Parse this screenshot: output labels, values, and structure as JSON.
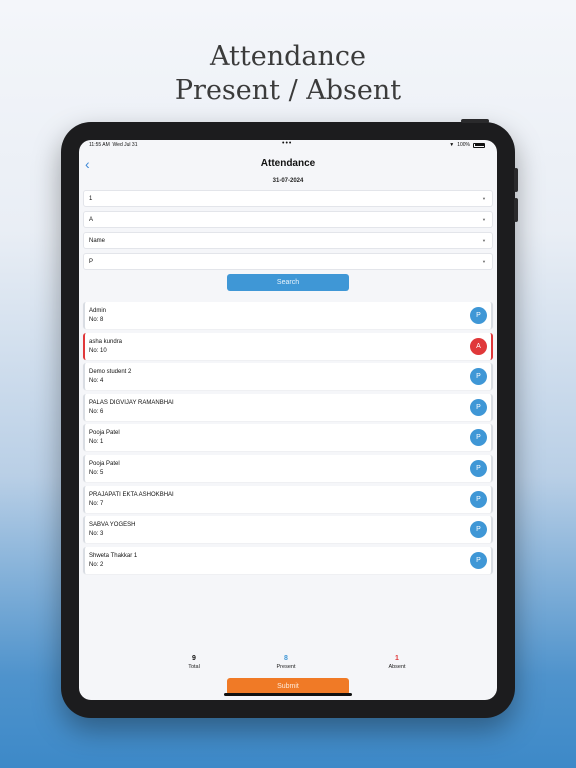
{
  "promo": {
    "line1": "Attendance",
    "line2": "Present / Absent"
  },
  "status_bar": {
    "time": "11:55 AM",
    "date": "Wed Jul 31",
    "dots": "•••",
    "battery": "100%"
  },
  "nav": {
    "back_icon": "chevron-left-icon",
    "title": "Attendance"
  },
  "date": "31-07-2024",
  "filters": [
    {
      "value": "1"
    },
    {
      "value": "A"
    },
    {
      "value": "Name"
    },
    {
      "value": "P"
    }
  ],
  "search_label": "Search",
  "students": [
    {
      "name": "Admin",
      "no": "No: 8",
      "status": "P"
    },
    {
      "name": "asha kundra",
      "no": "No: 10",
      "status": "A"
    },
    {
      "name": "Demo student 2",
      "no": "No: 4",
      "status": "P"
    },
    {
      "name": "PALAS DIGVIJAY RAMANBHAI",
      "no": "No: 6",
      "status": "P"
    },
    {
      "name": "Pooja Patel",
      "no": "No: 1",
      "status": "P"
    },
    {
      "name": "Pooja Patel",
      "no": "No: 5",
      "status": "P"
    },
    {
      "name": "PRAJAPATI EKTA ASHOKBHAI",
      "no": "No: 7",
      "status": "P"
    },
    {
      "name": "SABVA YOGESH",
      "no": "No: 3",
      "status": "P"
    },
    {
      "name": "Shweta Thakkar 1",
      "no": "No: 2",
      "status": "P"
    }
  ],
  "stats": {
    "total": {
      "value": "9",
      "label": "Total"
    },
    "present": {
      "value": "8",
      "label": "Present"
    },
    "absent": {
      "value": "1",
      "label": "Absent"
    }
  },
  "submit_label": "Submit",
  "colors": {
    "accent_blue": "#3f97d6",
    "absent_red": "#e0383a",
    "submit_orange": "#f07a26"
  }
}
